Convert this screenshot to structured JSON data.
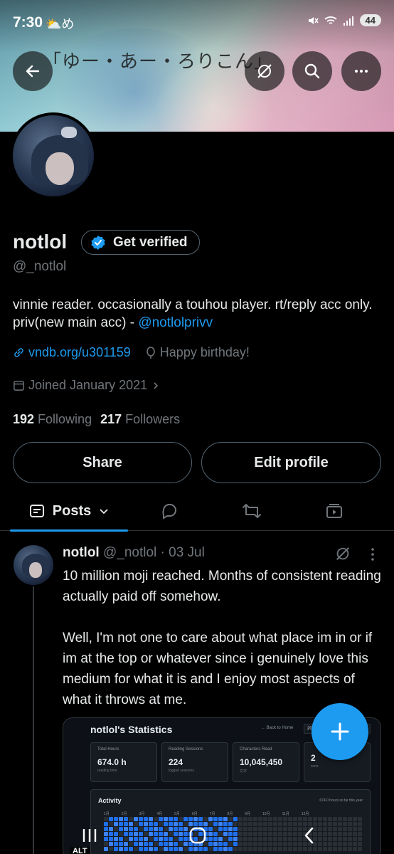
{
  "status_bar": {
    "time": "7:30",
    "weather_glyphs": "⛅め",
    "battery": "44"
  },
  "banner": {
    "title_text": "「ゆー・あー・ろりこん」"
  },
  "header": {
    "back_icon": "arrow-left-icon",
    "grok_icon": "grok-icon",
    "search_icon": "search-icon",
    "more_icon": "more-horizontal-icon"
  },
  "profile": {
    "name": "notlol",
    "verify_label": "Get verified",
    "handle": "@_notlol",
    "bio_text": "vinnie reader. occasionally a touhou player. rt/reply acc only. priv(new main acc) - ",
    "bio_mention": "@notlolprivv",
    "link": "vndb.org/u301159",
    "birthday": "Happy birthday!",
    "joined": "Joined January 2021",
    "following_count": "192",
    "following_label": "Following",
    "followers_count": "217",
    "followers_label": "Followers",
    "share_label": "Share",
    "edit_label": "Edit profile"
  },
  "tabs": {
    "posts_label": "Posts"
  },
  "post": {
    "author": "notlol",
    "handle_date": "@_notlol · 03 Jul",
    "text": "10 million moji reached. Months of consistent reading actually paid off somehow.\n\nWell, I'm not one to care about what place im in or if im at the top or whatever since i genuinely love this medium for what it is and I enjoy most aspects of what it throws at me.",
    "embed": {
      "title": "notlol's Statistics",
      "back_home": "← Back to Home",
      "year": "2026",
      "cards": [
        {
          "label": "Total Hours",
          "value": "674.0 h",
          "sub": "reading time"
        },
        {
          "label": "Reading Sessions",
          "value": "224",
          "sub": "logged sessions"
        },
        {
          "label": "Characters Read",
          "value": "10,045,450",
          "sub": "文字"
        },
        {
          "label": "",
          "value": "2",
          "sub": "cons"
        }
      ],
      "activity_title": "Activity",
      "activity_summary": "674.0 hours so far this year",
      "months": [
        "1月",
        "2月",
        "3月",
        "4月",
        "5月",
        "6月",
        "7月",
        "8月",
        "9月",
        "10月",
        "11月",
        "12月"
      ]
    },
    "alt_badge": "ALT"
  },
  "colors": {
    "accent": "#1d9bf0",
    "background": "#000000",
    "muted": "#71767b",
    "border": "#536471"
  }
}
